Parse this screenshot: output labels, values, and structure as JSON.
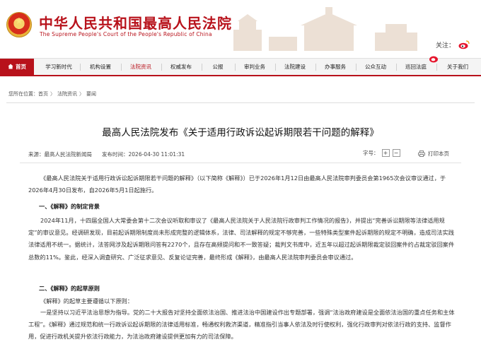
{
  "header": {
    "title": "中华人民共和国最高人民法院",
    "subtitle": "The Supreme People's Court of the People's Republic of China",
    "follow_label": "关注：",
    "emblem_icon": "national-emblem-icon",
    "weibo_icon": "weibo-icon"
  },
  "nav": {
    "items": [
      {
        "label": "首页"
      },
      {
        "label": "学习新时代"
      },
      {
        "label": "机构设置"
      },
      {
        "label": "法院资讯"
      },
      {
        "label": "权威发布"
      },
      {
        "label": "公报"
      },
      {
        "label": "审判业务"
      },
      {
        "label": "法院建设"
      },
      {
        "label": "办事服务"
      },
      {
        "label": "公众互动"
      },
      {
        "label": "巡回法庭"
      },
      {
        "label": "关于我们"
      }
    ],
    "active_color": "#b8121b"
  },
  "breadcrumb": {
    "prefix": "您所在位置：",
    "items": [
      "首页",
      "法院资讯",
      "要闻"
    ],
    "separator": "〉"
  },
  "article": {
    "title": "最高人民法院发布《关于适用行政诉讼起诉期限若干问题的解释》",
    "source": "来源：最高人民法院新闻局",
    "publish_time": "发布时间：2026-04-30 11:01:31",
    "font_size_label": "字号：",
    "font_increase": "+",
    "font_decrease": "−",
    "print_label": "打印本页",
    "paragraphs": {
      "p1": "《最高人民法院关于适用行政诉讼起诉期限若干问题的解释》（以下简称《解释》）已于2026年1月12日由最高人民法院审判委员会第1965次会议审议通过，于2026年4月30日发布，自2026年5月1日起施行。",
      "h1": "一、《解释》的制定背景",
      "p2": "2024年11月，十四届全国人大常委会第十二次会议听取和审议了《最高人民法院关于人民法院行政审判工作情况的报告》，并提出“完善诉讼期限等法律适用规定”的审议意见。经调研发现，目前起诉期限制度尚未形成完整的逻辑体系，法律、司法解释的规定不够完善，一些特殊类型案件起诉期限的规定不明确，造成司法实践法律适用不统一。据统计，法答网涉及起诉期限问答有2270个，且存在高频提问和不一致答疑；裁判文书库中，近五年以超过起诉期限裁定驳回案件约占裁定驳回案件总数的11%。鉴此，经深入调查研究、广泛征求意见、反复论证完善，最终形成《解释》，由最高人民法院审判委员会审议通过。",
      "h2": "二、《解释》的起草原则",
      "p3": "《解释》的起草主要遵循以下原则：",
      "p4": "一是坚持以习近平法治思想为指导。党的二十大报告对坚持全面依法治国、推进法治中国建设作出专题部署，强调“法治政府建设是全面依法治国的重点任务和主体工程”。《解释》通过规范和统一行政诉讼起诉期限的法律适用标准，畅通权利救济渠道，精准指引当事人依法及时行使权利，强化行政审判对依法行政的支持、监督作用，促进行政机关提升依法行政能力，为法治政府建设提供更加有力的司法保障。"
    }
  }
}
